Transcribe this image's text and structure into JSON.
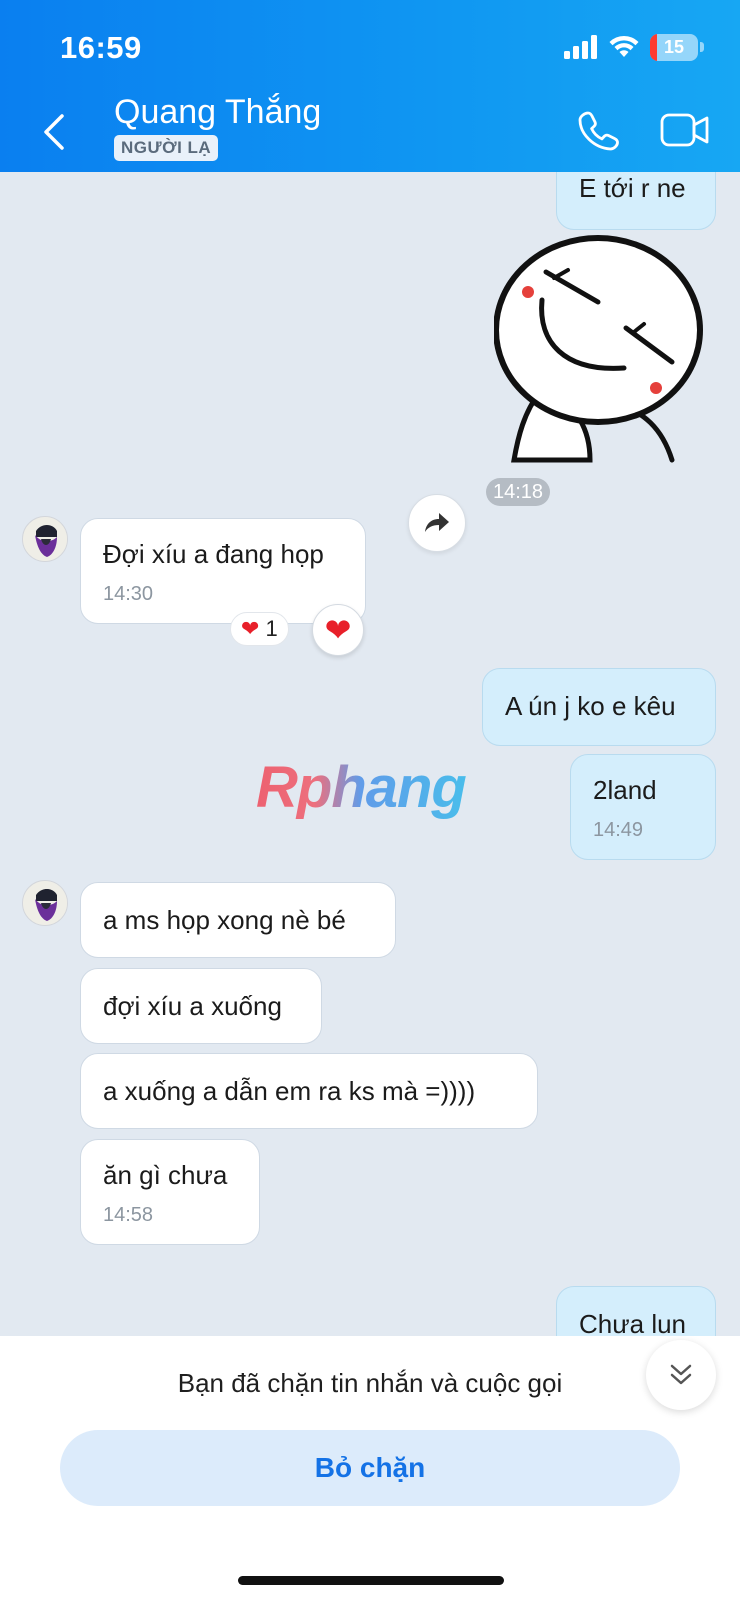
{
  "status_bar": {
    "time": "16:59",
    "battery": "15"
  },
  "header": {
    "contact_name": "Quang Thắng",
    "badge": "NGƯỜI LẠ",
    "icons": [
      "back-icon",
      "phone-icon",
      "video-call-icon"
    ]
  },
  "messages": [
    {
      "side": "out",
      "text": "E tới r ne"
    },
    {
      "side": "out",
      "type": "sticker",
      "time": "14:18"
    },
    {
      "side": "in",
      "text": "Đợi xíu a đang họp",
      "time": "14:30",
      "reaction": {
        "emoji": "❤️",
        "count": "1"
      }
    },
    {
      "side": "out",
      "text": "A ún j ko e kêu"
    },
    {
      "side": "out",
      "text": "2land",
      "time": "14:49"
    },
    {
      "side": "in",
      "text": "a ms họp xong nè bé"
    },
    {
      "side": "in",
      "text": "đợi xíu a xuống"
    },
    {
      "side": "in",
      "text": "a xuống a dẫn em ra ks mà =))))"
    },
    {
      "side": "in",
      "text": "ăn gì chưa",
      "time": "14:58"
    },
    {
      "side": "out",
      "text": "Chưa lun"
    }
  ],
  "watermark": "Rphang",
  "block_bar": {
    "notice": "Bạn đã chặn tin nhắn và cuộc gọi",
    "unblock_label": "Bỏ chặn"
  },
  "colors": {
    "header": "#0a7ff0",
    "out_bubble": "#d4eefc",
    "in_bubble": "#ffffff",
    "chat_bg": "#e2e9f1",
    "accent": "#1472e6"
  }
}
